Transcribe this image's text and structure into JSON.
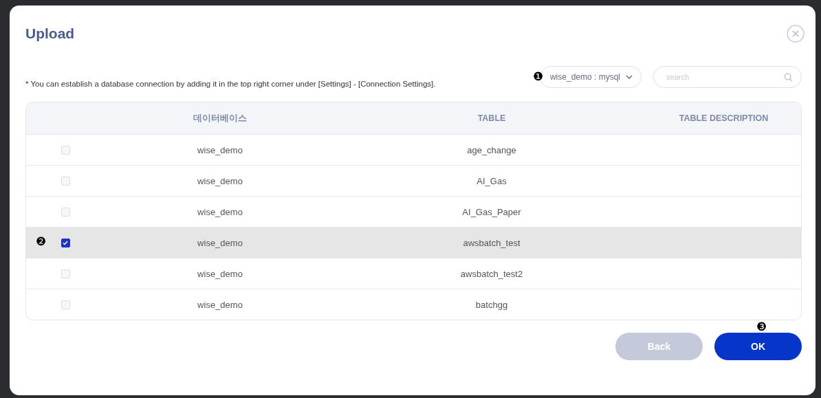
{
  "dialog": {
    "title": "Upload"
  },
  "notice": "* You can establish a database connection by adding it in the top right corner under [Settings] - [Connection Settings].",
  "connection_select": {
    "callout": "❶",
    "value": "wise_demo : mysql"
  },
  "search": {
    "placeholder": "search"
  },
  "table": {
    "columns": [
      "데이터베이스",
      "TABLE",
      "TABLE DESCRIPTION"
    ],
    "rows": [
      {
        "checked": false,
        "database": "wise_demo",
        "table": "age_change"
      },
      {
        "checked": false,
        "database": "wise_demo",
        "table": "AI_Gas"
      },
      {
        "checked": false,
        "database": "wise_demo",
        "table": "AI_Gas_Paper"
      },
      {
        "checked": true,
        "callout": "❷",
        "database": "wise_demo",
        "table": "awsbatch_test"
      },
      {
        "checked": false,
        "database": "wise_demo",
        "table": "awsbatch_test2"
      },
      {
        "checked": false,
        "database": "wise_demo",
        "table": "batchgg"
      }
    ]
  },
  "buttons": [
    {
      "kind": "secondary",
      "label": "Back"
    },
    {
      "kind": "primary",
      "label": "OK",
      "callout": "❸"
    }
  ]
}
